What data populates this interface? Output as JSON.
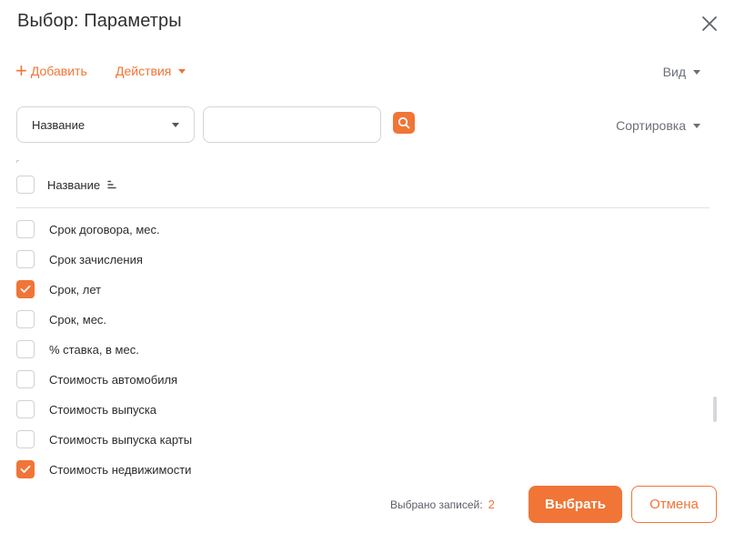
{
  "dialog": {
    "title": "Выбор: Параметры"
  },
  "toolbar": {
    "add_label": "Добавить",
    "actions_label": "Действия",
    "view_label": "Вид"
  },
  "filter": {
    "field_selected": "Название",
    "search_value": "",
    "search_placeholder": "",
    "sort_label": "Сортировка"
  },
  "table": {
    "column_header": "Название",
    "rows": [
      {
        "label": "Срок договора, мес.",
        "checked": false
      },
      {
        "label": "Срок зачисления",
        "checked": false
      },
      {
        "label": "Срок, лет",
        "checked": true
      },
      {
        "label": "Срок, мес.",
        "checked": false
      },
      {
        "label": "% ставка, в мес.",
        "checked": false
      },
      {
        "label": "Стоимость автомобиля",
        "checked": false
      },
      {
        "label": "Стоимость выпуска",
        "checked": false
      },
      {
        "label": "Стоимость выпуска карты",
        "checked": false
      },
      {
        "label": "Стоимость недвижимости",
        "checked": true
      }
    ]
  },
  "footer": {
    "selected_label": "Выбрано записей:",
    "selected_count": "2",
    "select_button": "Выбрать",
    "cancel_button": "Отмена"
  },
  "colors": {
    "accent": "#f07537",
    "muted_text": "#6b6f78",
    "border": "#d3d5d9"
  }
}
